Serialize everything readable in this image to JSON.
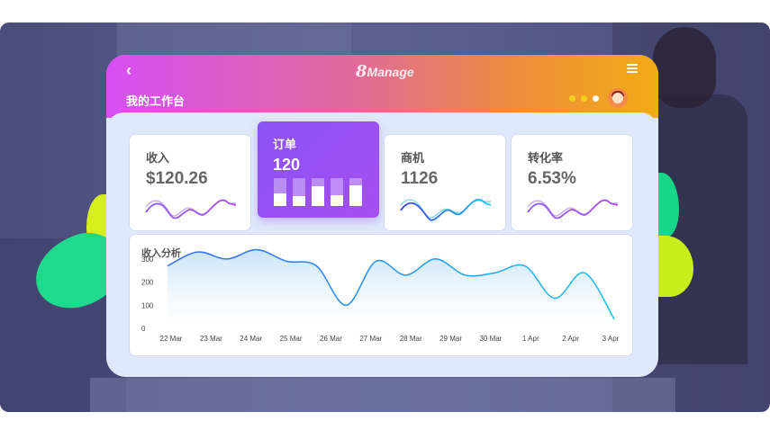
{
  "app": {
    "logo_num": "8",
    "logo_text": "Manage",
    "page_title": "我的工作台",
    "back_icon": "chevron-left-icon",
    "menu_icon": "hamburger-menu-icon",
    "dots": [
      {
        "active": false
      },
      {
        "active": false
      },
      {
        "active": true
      }
    ]
  },
  "colors": {
    "header_start": "#d74ef5",
    "header_end": "#f2ac16",
    "accent_purple": "#9b4ff2",
    "line_blue": "#3a6ff0",
    "line_cyan": "#22c4e8"
  },
  "cards": {
    "revenue": {
      "label": "收入",
      "value": "$120.26"
    },
    "orders": {
      "label": "订单",
      "value": "120",
      "bars": [
        0.45,
        0.35,
        0.7,
        0.4,
        0.75
      ]
    },
    "opportunities": {
      "label": "商机",
      "value": "1126"
    },
    "conversion": {
      "label": "转化率",
      "value": "6.53%"
    }
  },
  "analysis": {
    "title": "收入分析"
  },
  "chart_data": {
    "type": "area",
    "title": "收入分析",
    "x": [
      "22 Mar",
      "23 Mar",
      "24 Mar",
      "25 Mar",
      "26 Mar",
      "27 Mar",
      "28 Mar",
      "29 Mar",
      "30 Mar",
      "1 Apr",
      "2 Apr",
      "3 Apr"
    ],
    "series": [
      {
        "values": [
          270,
          330,
          300,
          340,
          290,
          270,
          100,
          290,
          230,
          300,
          230,
          240,
          270,
          130,
          240,
          40
        ]
      }
    ],
    "yticks": [
      0,
      100,
      200,
      300
    ],
    "ylim": [
      0,
      350
    ],
    "grid": false
  }
}
